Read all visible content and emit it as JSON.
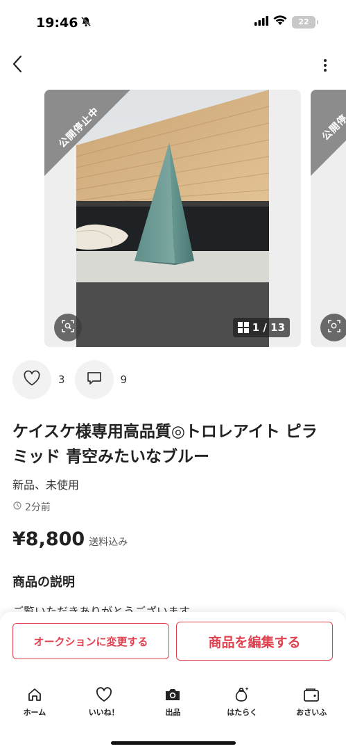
{
  "status_bar": {
    "time": "19:46",
    "battery": "22",
    "icons": [
      "bell-slash-icon",
      "signal-icon",
      "wifi-icon",
      "battery-icon"
    ]
  },
  "nav": {
    "back_icon": "chevron-left-icon",
    "more_icon": "more-vertical-icon"
  },
  "carousel": {
    "ribbon_label": "公開停止中",
    "next_ribbon_label": "公開停",
    "counter": "1 / 13",
    "zoom_icon": "scan-zoom-icon",
    "grid_icon": "grid-icon"
  },
  "engagement": {
    "likes": "3",
    "comments": "9",
    "like_icon": "heart-icon",
    "comment_icon": "comment-icon"
  },
  "item": {
    "title": "ケイスケ様専用高品質◎トロレアイト ピラミッド 青空みたいなブルー",
    "condition": "新品、未使用",
    "posted": "2分前",
    "price": "¥8,800",
    "shipping": "送料込み",
    "description_heading": "商品の説明",
    "description_peek": "ご覧いただきありがとうございます"
  },
  "actions": {
    "auction_label": "オークションに変更する",
    "edit_label": "商品を編集する"
  },
  "tabbar": [
    {
      "label": "ホーム",
      "icon": "home-icon"
    },
    {
      "label": "いいね！",
      "icon": "heart-icon"
    },
    {
      "label": "出品",
      "icon": "camera-icon"
    },
    {
      "label": "はたらく",
      "icon": "money-bag-icon"
    },
    {
      "label": "おさいふ",
      "icon": "wallet-icon"
    }
  ],
  "colors": {
    "accent": "#e0414f",
    "ribbon": "#8c8c8c"
  }
}
